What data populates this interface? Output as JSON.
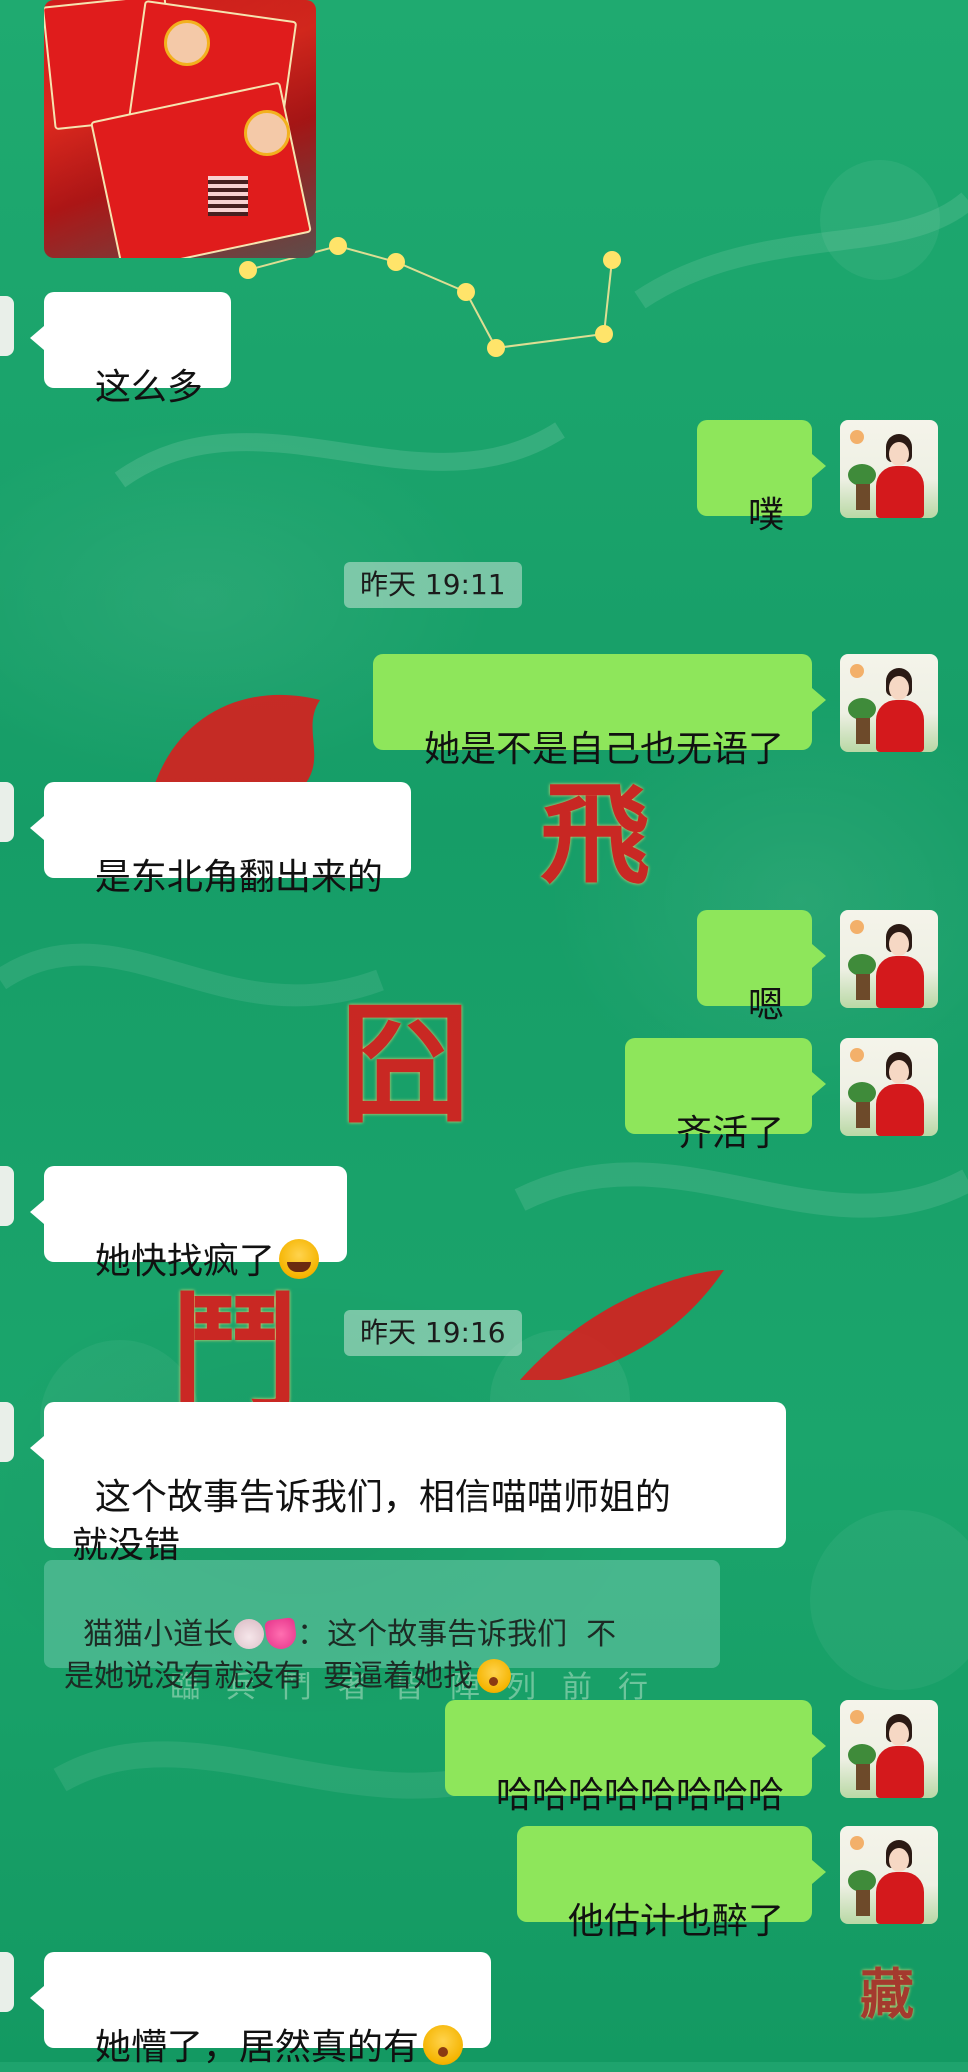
{
  "chat": {
    "messages": [
      {
        "side": "left",
        "text": "这么多"
      },
      {
        "side": "right",
        "text": "噗"
      },
      {
        "side": "right",
        "text": "她是不是自己也无语了"
      },
      {
        "side": "left",
        "text": "是东北角翻出来的"
      },
      {
        "side": "right",
        "text": "嗯"
      },
      {
        "side": "right",
        "text": "齐活了"
      },
      {
        "side": "left",
        "text": "她快找疯了",
        "emoji": "laughing-tears-emoji"
      },
      {
        "side": "left",
        "text": "这个故事告诉我们，相信喵喵师姐的\n就没错"
      },
      {
        "side": "right",
        "text": "哈哈哈哈哈哈哈哈"
      },
      {
        "side": "right",
        "text": "他估计也醉了"
      },
      {
        "side": "left",
        "text": "她懵了，居然真的有",
        "emoji": "kissing-face-emoji"
      }
    ],
    "timestamps": [
      "昨天 19:11",
      "昨天 19:16"
    ],
    "quote": {
      "name": "猫猫小道长",
      "name_icons": [
        "rabbit-icon",
        "heart-icon"
      ],
      "separator": "：",
      "line1": "这个故事告诉我们  不",
      "line2": "是她说没有就没有  要逼着她找",
      "emoji": "kissing-face-emoji"
    }
  },
  "background": {
    "glyphs": [
      "臨",
      "兵",
      "鬥",
      "者",
      "皆",
      "陣",
      "列",
      "前",
      "行"
    ],
    "corner_glyph": "藏",
    "colors": {
      "bg": "#1ea36d",
      "bubble_right": "#8ee65b",
      "bubble_left": "#ffffff",
      "glyph": "#d81e1e"
    }
  }
}
